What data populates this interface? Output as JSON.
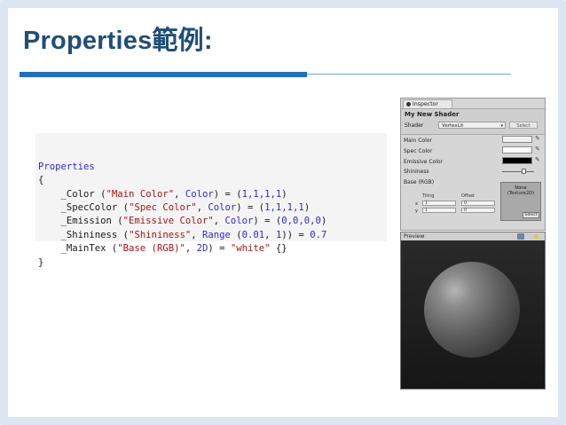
{
  "slide": {
    "title": "Properties範例:"
  },
  "code": {
    "lines": [
      {
        "segments": [
          {
            "t": "Properties",
            "c": "kw"
          }
        ]
      },
      {
        "segments": [
          {
            "t": "{",
            "c": ""
          }
        ]
      },
      {
        "segments": [
          {
            "t": "    _Color (",
            "c": ""
          },
          {
            "t": "\"Main Color\"",
            "c": "str"
          },
          {
            "t": ", ",
            "c": ""
          },
          {
            "t": "Color",
            "c": "kw"
          },
          {
            "t": ") = (",
            "c": ""
          },
          {
            "t": "1,1,1,1",
            "c": "num"
          },
          {
            "t": ")",
            "c": ""
          }
        ]
      },
      {
        "segments": [
          {
            "t": "    _SpecColor (",
            "c": ""
          },
          {
            "t": "\"Spec Color\"",
            "c": "str"
          },
          {
            "t": ", ",
            "c": ""
          },
          {
            "t": "Color",
            "c": "kw"
          },
          {
            "t": ") = (",
            "c": ""
          },
          {
            "t": "1,1,1,1",
            "c": "num"
          },
          {
            "t": ")",
            "c": ""
          }
        ]
      },
      {
        "segments": [
          {
            "t": "    _Emission (",
            "c": ""
          },
          {
            "t": "\"Emissive Color\"",
            "c": "str"
          },
          {
            "t": ", ",
            "c": ""
          },
          {
            "t": "Color",
            "c": "kw"
          },
          {
            "t": ") = (",
            "c": ""
          },
          {
            "t": "0,0,0,0",
            "c": "num"
          },
          {
            "t": ")",
            "c": ""
          }
        ]
      },
      {
        "segments": [
          {
            "t": "    _Shininess (",
            "c": ""
          },
          {
            "t": "\"Shininess\"",
            "c": "str"
          },
          {
            "t": ", ",
            "c": ""
          },
          {
            "t": "Range",
            "c": "kw"
          },
          {
            "t": " (",
            "c": ""
          },
          {
            "t": "0.01",
            "c": "num"
          },
          {
            "t": ", ",
            "c": ""
          },
          {
            "t": "1",
            "c": "num"
          },
          {
            "t": ")) = ",
            "c": ""
          },
          {
            "t": "0.7",
            "c": "num"
          }
        ]
      },
      {
        "segments": [
          {
            "t": "    _MainTex (",
            "c": ""
          },
          {
            "t": "\"Base (RGB)\"",
            "c": "str"
          },
          {
            "t": ", ",
            "c": ""
          },
          {
            "t": "2D",
            "c": "kw"
          },
          {
            "t": ") = ",
            "c": ""
          },
          {
            "t": "\"white\"",
            "c": "str"
          },
          {
            "t": " {}",
            "c": ""
          }
        ]
      },
      {
        "segments": [
          {
            "t": "}",
            "c": ""
          }
        ]
      }
    ]
  },
  "inspector": {
    "tab_label": "Inspector",
    "material_name": "My New Shader",
    "shader_label": "Shader",
    "shader_value": "VertexLit",
    "shader_select": "Select",
    "props": {
      "main_color": "Main Color",
      "spec_color": "Spec Color",
      "emissive_color": "Emissive Color",
      "shininess": "Shininess",
      "base": "Base (RGB)"
    },
    "texture": {
      "none_label": "None",
      "type_label": "(Texture2D)",
      "select_label": "Select"
    },
    "tiling_label": "Tiling",
    "offset_label": "Offset",
    "x_label": "x",
    "y_label": "y",
    "tiling_x": "1",
    "tiling_y": "1",
    "offset_x": "0",
    "offset_y": "0",
    "shininess_value": 0.7,
    "colors": {
      "main": "#f2f2f2",
      "spec": "#ffffff",
      "emissive": "#000000"
    }
  },
  "preview": {
    "label": "Preview"
  },
  "colors": {
    "title": "#1f4e79",
    "accent_bar": "#1f6fc5",
    "keyword": "#2b2bd6",
    "string": "#a31515"
  }
}
